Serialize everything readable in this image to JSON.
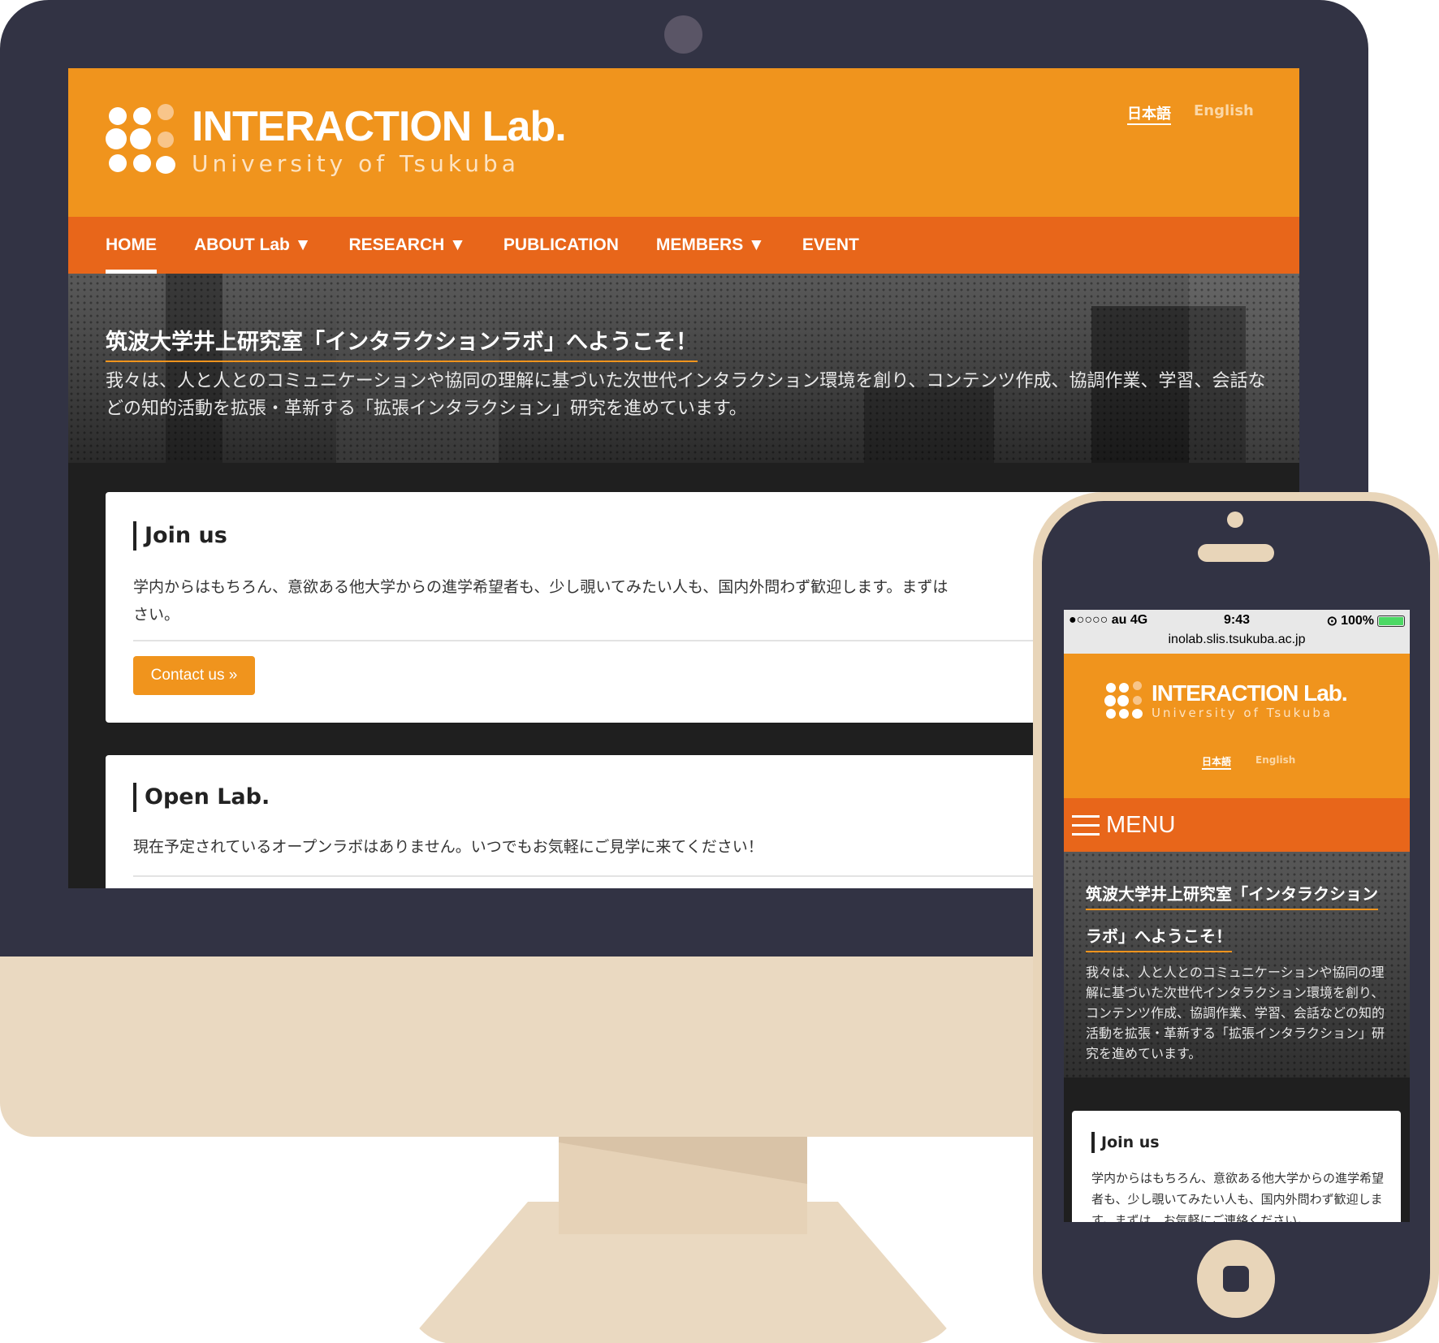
{
  "site": {
    "logo_title": "INTERACTION Lab.",
    "logo_subtitle": "University of Tsukuba",
    "lang_ja": "日本語",
    "lang_en": "English"
  },
  "desktop_nav": [
    {
      "label": "HOME"
    },
    {
      "label": "ABOUT Lab ▼"
    },
    {
      "label": "RESEARCH ▼"
    },
    {
      "label": "PUBLICATION"
    },
    {
      "label": "MEMBERS ▼"
    },
    {
      "label": "EVENT"
    }
  ],
  "hero": {
    "title": "筑波大学井上研究室「インタラクションラボ」へようこそ！",
    "text": "我々は、人と人とのコミュニケーションや協同の理解に基づいた次世代インタラクション環境を創り、コンテンツ作成、協調作業、学習、会話などの知的活動を拡張・革新する「拡張インタラクション」研究を進めています。",
    "title_mobile_1": "筑波大学井上研究室「インタラクション",
    "title_mobile_2": "ラボ」へようこそ！"
  },
  "join_card": {
    "title": "Join us",
    "text_desktop": "学内からはもちろん、意欲ある他大学からの進学希望者も、少し覗いてみたい人も、国内外問わず歓迎します。まずは",
    "text_desktop_2": "さい。",
    "text_mobile": "学内からはもちろん、意欲ある他大学からの進学希望者も、少し覗いてみたい人も、国内外問わず歓迎します。まずは、お気軽にご連絡ください。",
    "button": "Contact us »"
  },
  "open_lab_card": {
    "title": "Open Lab.",
    "text": "現在予定されているオープンラボはありません。いつでもお気軽にご見学に来てください！"
  },
  "phone_status": {
    "carrier": "●○○○○ au  4G",
    "time": "9:43",
    "battery": "100%",
    "url": "inolab.slis.tsukuba.ac.jp"
  },
  "mobile_menu": {
    "label": "MENU"
  },
  "colors": {
    "monitor_frame": "#323344",
    "monitor_stand": "#ead9c1",
    "header_orange": "#f0941d",
    "nav_orange": "#e8661a"
  }
}
